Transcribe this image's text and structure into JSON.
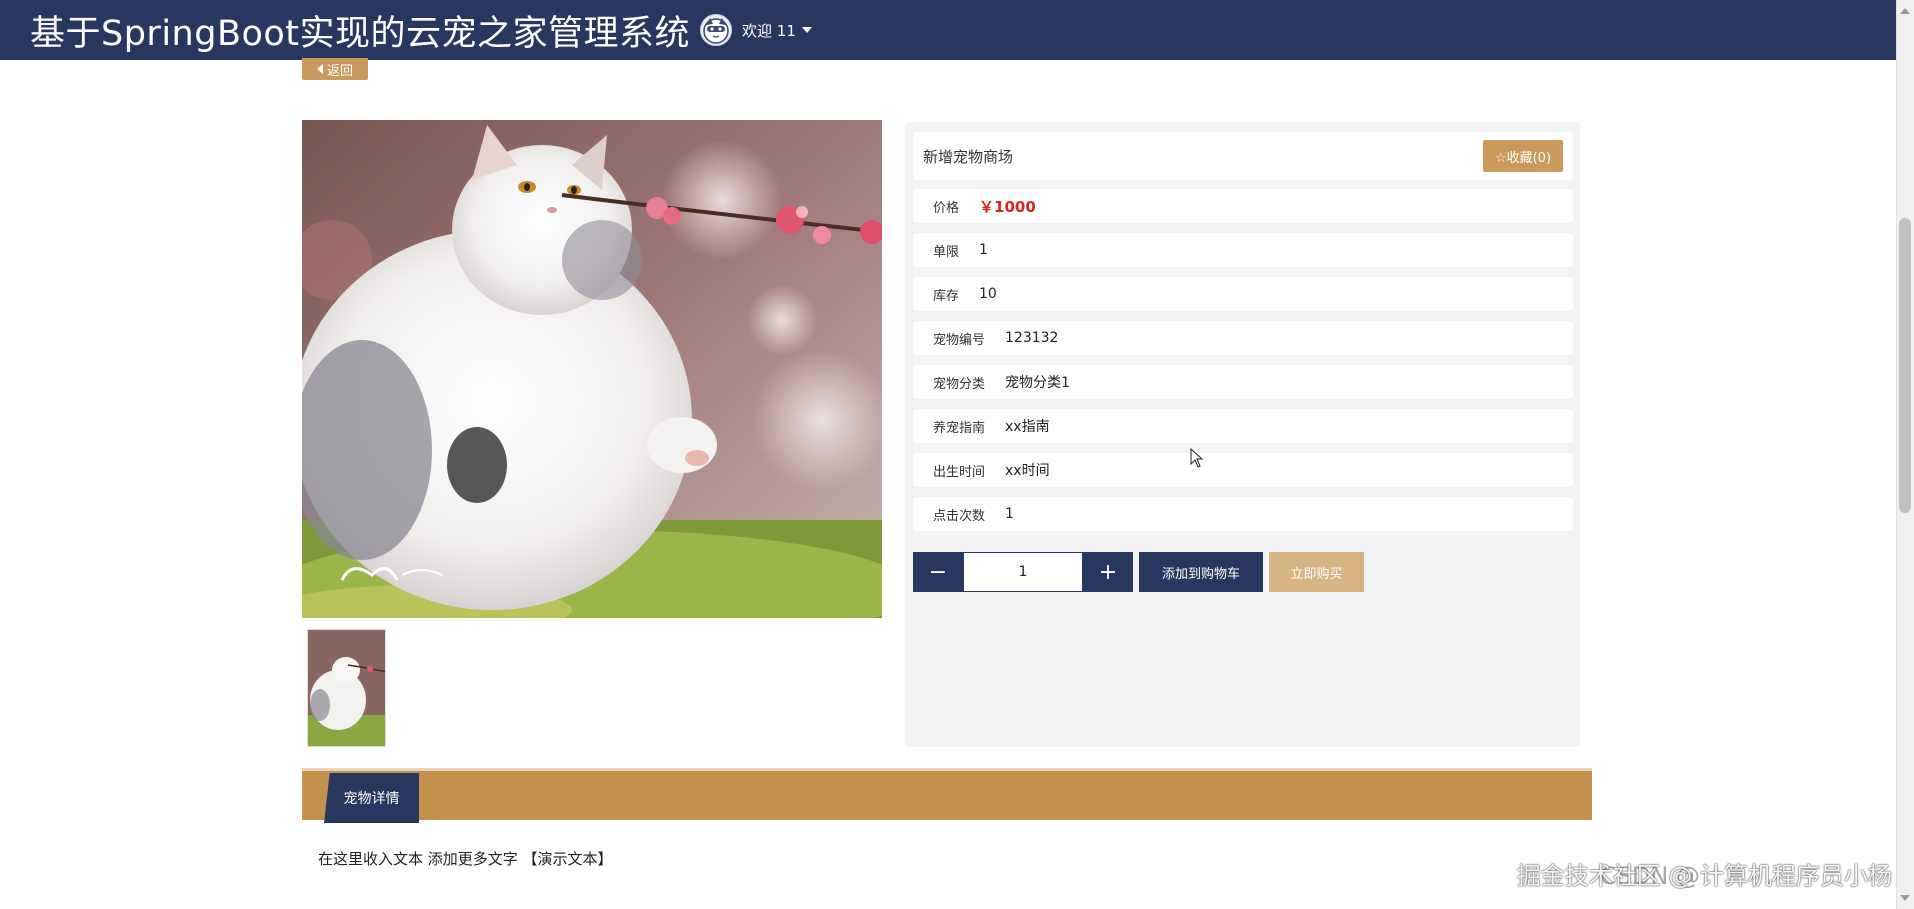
{
  "header": {
    "title": "基于SpringBoot实现的云宠之家管理系统",
    "welcome": "欢迎 11"
  },
  "nav": {
    "back_label": "返回"
  },
  "product": {
    "name": "新增宠物商场",
    "favorite_label": "☆收藏(0)",
    "attributes": [
      {
        "label": "价格",
        "value": "￥1000"
      },
      {
        "label": "单限",
        "value": "1"
      },
      {
        "label": "库存",
        "value": "10"
      },
      {
        "label": "宠物编号",
        "value": "123132"
      },
      {
        "label": "宠物分类",
        "value": "宠物分类1"
      },
      {
        "label": "养宠指南",
        "value": "xx指南"
      },
      {
        "label": "出生时间",
        "value": "xx时间"
      },
      {
        "label": "点击次数",
        "value": "1"
      }
    ],
    "quantity": "1",
    "minus_label": "−",
    "plus_label": "+",
    "add_to_cart_label": "添加到购物车",
    "buy_now_label": "立即购买"
  },
  "details": {
    "tab_label": "宠物详情",
    "content": "在这里收入文本 添加更多文字 【演示文本】"
  },
  "watermark": {
    "text": "CSDN @计算机程序员小杨",
    "overlay": "掘金技术社区 @ 计算机程序员小杨"
  },
  "colors": {
    "navy": "#283760",
    "gold": "#c4914d",
    "light_gold": "#d8b483",
    "price_red": "#d9251d"
  },
  "icons": {
    "avatar": "cartoon-avatar-icon",
    "caret": "caret-down-icon",
    "back": "chevron-left-icon",
    "star": "star-outline-icon"
  }
}
